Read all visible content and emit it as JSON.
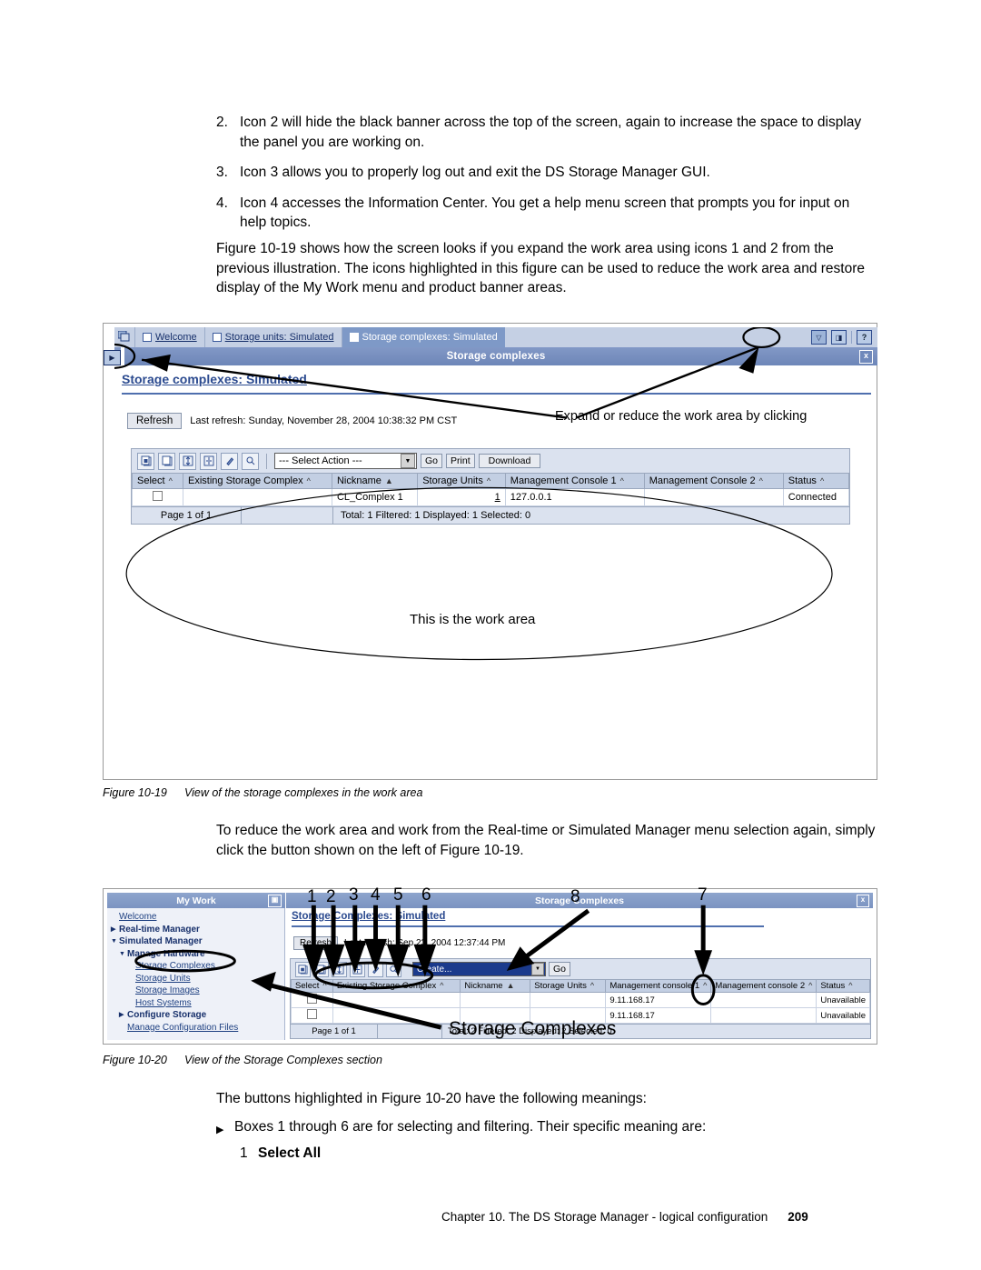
{
  "numbered_items": [
    {
      "n": "2.",
      "text": "Icon 2 will hide the black banner across the top of the screen, again to increase the space to display the panel you are working on."
    },
    {
      "n": "3.",
      "text": "Icon 3 allows you to properly log out and exit the DS Storage Manager GUI."
    },
    {
      "n": "4.",
      "text": "Icon 4 accesses the Information Center. You get a help menu screen that prompts you for input on help topics."
    }
  ],
  "intro_paragraph": "Figure 10-19 shows how the screen looks if you expand the work area using icons 1 and 2 from the previous illustration. The icons highlighted in this figure can be used to reduce the work area and restore display of the My Work menu and product banner areas.",
  "figure19": {
    "caption_label": "Figure 10-19",
    "caption_text": "View of the storage complexes in the work area",
    "tabs": [
      {
        "label": "Welcome",
        "active": false
      },
      {
        "label": "Storage units: Simulated",
        "active": false
      },
      {
        "label": "Storage complexes: Simulated",
        "active": true
      }
    ],
    "toolbar_right": {
      "expand_icon": "expand-workarea-icon",
      "exit_icon": "exit-icon",
      "help_icon": "?"
    },
    "banner_title": "Storage complexes",
    "banner_close": "x",
    "collapse_button": "▶",
    "panel_heading": "Storage complexes: Simulated",
    "refresh_button": "Refresh",
    "refresh_status": "Last refresh: Sunday, November 28, 2004 10:38:32 PM CST",
    "annotation_expand": "Expand or reduce the work area by clicking",
    "annotation_workarea": "This is the work area",
    "toolbar": {
      "icons": [
        "select-all-icon",
        "deselect-all-icon",
        "expand-rows-icon",
        "collapse-rows-icon",
        "edit-filter-icon",
        "clear-filter-icon"
      ],
      "select_action": "--- Select Action ---",
      "go_button": "Go",
      "print_button": "Print",
      "download_button": "Download"
    },
    "table": {
      "headers": [
        "Select",
        "Existing Storage Complex",
        "Nickname",
        "Storage Units",
        "Management Console 1",
        "Management Console 2",
        "Status"
      ],
      "sort_marks": [
        "^",
        "^",
        "▲",
        "^",
        "^",
        "^",
        "^"
      ],
      "rows": [
        {
          "select": "",
          "existing": "",
          "nickname": "CL_Complex 1",
          "units": "1",
          "mc1": "127.0.0.1",
          "mc2": "",
          "status": "Connected"
        }
      ],
      "page_label": "Page 1 of 1",
      "summary": "Total: 1   Filtered: 1   Displayed: 1   Selected: 0"
    }
  },
  "middle_paragraph": "To reduce the work area and work from the Real-time or Simulated Manager menu selection again, simply click the button shown on the left of Figure 10-19.",
  "figure20": {
    "caption_label": "Figure 10-20",
    "caption_text": "View of the Storage Complexes section",
    "sidebar": {
      "title": "My Work",
      "expand_icon": "▣",
      "items": [
        {
          "label": "Welcome",
          "indent": 0,
          "style": "link",
          "marker": ""
        },
        {
          "label": "Real-time Manager",
          "indent": 0,
          "style": "bold",
          "marker": "▶"
        },
        {
          "label": "Simulated Manager",
          "indent": 0,
          "style": "bold",
          "marker": "▼"
        },
        {
          "label": "Manage Hardware",
          "indent": 1,
          "style": "bold",
          "marker": "▼"
        },
        {
          "label": "Storage Complexes",
          "indent": 2,
          "style": "link",
          "marker": ""
        },
        {
          "label": "Storage Units",
          "indent": 2,
          "style": "link",
          "marker": ""
        },
        {
          "label": "Storage Images",
          "indent": 2,
          "style": "link",
          "marker": ""
        },
        {
          "label": "Host Systems",
          "indent": 2,
          "style": "link",
          "marker": ""
        },
        {
          "label": "Configure Storage",
          "indent": 1,
          "style": "bold",
          "marker": "▶"
        },
        {
          "label": "Manage Configuration Files",
          "indent": 1,
          "style": "link",
          "marker": ""
        }
      ]
    },
    "banner_title": "Storage Complexes",
    "banner_close": "x",
    "panel_heading": "Storage Complexes: Simulated",
    "refresh_button": "Refresh",
    "refresh_status": "Last refresh: Sep 23, 2004 12:37:44 PM",
    "toolbar": {
      "icons": [
        "select-all-icon",
        "deselect-all-icon",
        "expand-rows-icon",
        "collapse-rows-icon",
        "edit-filter-icon",
        "clear-filter-icon"
      ],
      "action_value": "Create...",
      "go_button": "Go"
    },
    "table": {
      "headers": [
        "Select",
        "Existing Storage Complex",
        "Nickname",
        "Storage Units",
        "Management console 1",
        "Management console 2",
        "Status"
      ],
      "rows": [
        {
          "select": "",
          "existing": "",
          "nickname": "",
          "units": "",
          "mc1": "9.11.168.17",
          "mc2": "",
          "status": "Unavailable"
        },
        {
          "select": "",
          "existing": "",
          "nickname": "",
          "units": "",
          "mc1": "9.11.168.17",
          "mc2": "",
          "status": "Unavailable"
        }
      ],
      "page_label": "Page 1 of 1",
      "summary": "Total: 2  Filtered: 2  Displayed: 2  Selected: 0"
    },
    "callouts": [
      "1",
      "2",
      "3",
      "4",
      "5",
      "6",
      "7",
      "8"
    ],
    "overlay_label": "Storage Complexes"
  },
  "trailing": {
    "lead": "The buttons highlighted in Figure 10-20 have the following meanings:",
    "bullet": "Boxes 1 through 6 are for selecting and filtering. Their specific meaning are:",
    "sub_num": "1",
    "sub_label": "Select All"
  },
  "footer": {
    "text": "Chapter 10. The DS Storage Manager - logical configuration",
    "page": "209"
  }
}
